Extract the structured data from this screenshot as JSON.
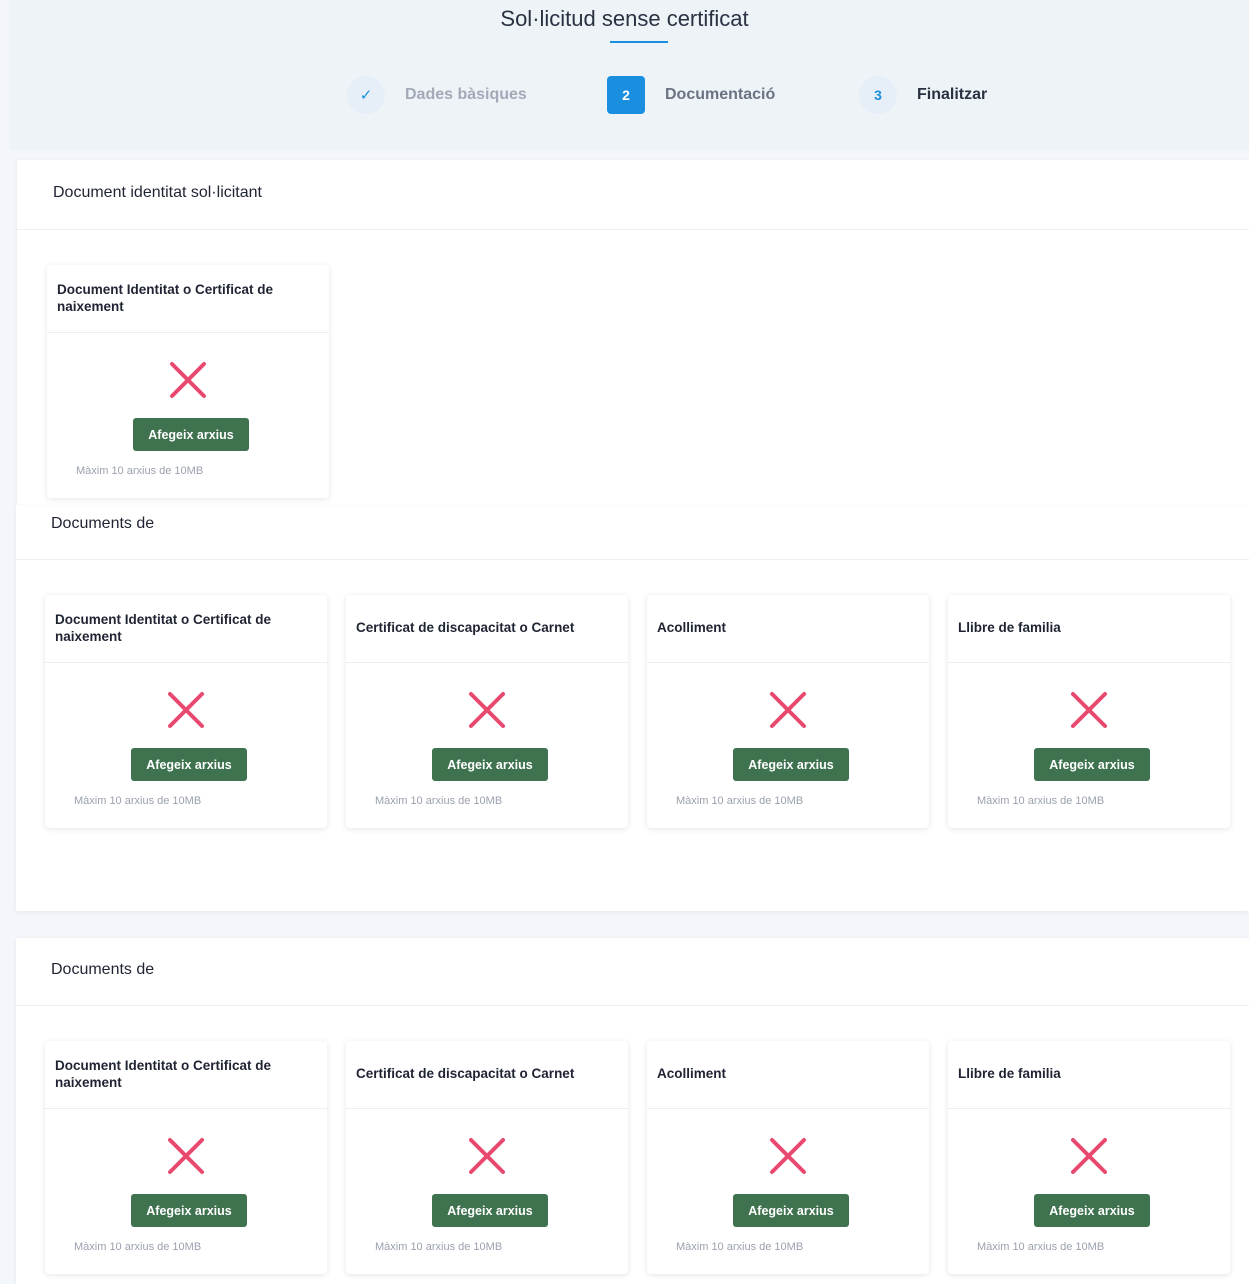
{
  "page": {
    "title": "Sol·licitud sense certificat"
  },
  "steps": [
    {
      "marker": "✓",
      "label": "Dades bàsiques",
      "state": "done"
    },
    {
      "marker": "2",
      "label": "Documentació",
      "state": "active"
    },
    {
      "marker": "3",
      "label": "Finalitzar",
      "state": "todo"
    }
  ],
  "sections": [
    {
      "title": "Document identitat sol·licitant",
      "cards": [
        {
          "title": "Document Identitat o Certificat de naixement",
          "button": "Afegeix arxius",
          "note": "Màxim 10 arxius de 10MB"
        }
      ]
    },
    {
      "title": "Documents de",
      "cards": [
        {
          "title": "Document Identitat o Certificat de naixement",
          "button": "Afegeix arxius",
          "note": "Màxim 10 arxius de 10MB"
        },
        {
          "title": "Certificat de discapacitat o Carnet",
          "button": "Afegeix arxius",
          "note": "Màxim 10 arxius de 10MB"
        },
        {
          "title": "Acolliment",
          "button": "Afegeix arxius",
          "note": "Màxim 10 arxius de 10MB"
        },
        {
          "title": "Llibre de familia",
          "button": "Afegeix arxius",
          "note": "Màxim 10 arxius de 10MB"
        }
      ]
    },
    {
      "title": "Documents de",
      "cards": [
        {
          "title": "Document Identitat o Certificat de naixement",
          "button": "Afegeix arxius",
          "note": "Màxim 10 arxius de 10MB"
        },
        {
          "title": "Certificat de discapacitat o Carnet",
          "button": "Afegeix arxius",
          "note": "Màxim 10 arxius de 10MB"
        },
        {
          "title": "Acolliment",
          "button": "Afegeix arxius",
          "note": "Màxim 10 arxius de 10MB"
        },
        {
          "title": "Llibre de familia",
          "button": "Afegeix arxius",
          "note": "Màxim 10 arxius de 10MB"
        }
      ]
    }
  ],
  "colors": {
    "accent": "#1a8fe0",
    "button": "#3f7350",
    "missing_icon": "#e84a6f"
  }
}
